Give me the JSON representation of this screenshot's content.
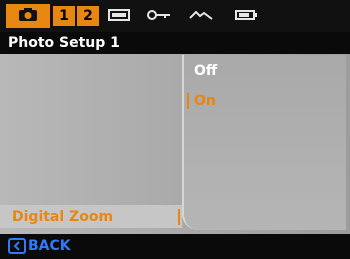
{
  "tabs": {
    "camera_icon": "camera-icon",
    "numbers": [
      "1",
      "2"
    ],
    "other_icons": [
      "screen-icon",
      "key-icon",
      "waveform-icon",
      "battery-icon"
    ]
  },
  "header": {
    "title": "Photo Setup 1"
  },
  "menu": {
    "selected_item": "Digital Zoom"
  },
  "options": {
    "off": "Off",
    "on": "On",
    "selected": "On"
  },
  "footer": {
    "back_label": "BACK",
    "back_icon": "left-arrow-icon"
  },
  "colors": {
    "accent": "#e8870f",
    "back": "#2f7aff"
  }
}
